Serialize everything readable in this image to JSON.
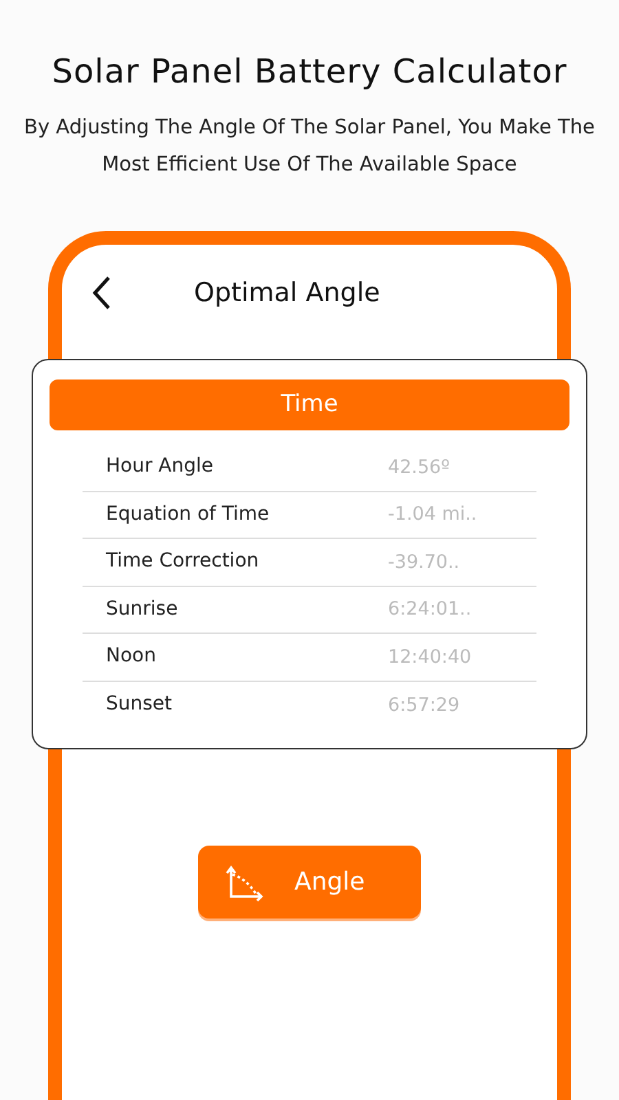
{
  "title": "Solar Panel Battery Calculator",
  "subtitle": "By Adjusting The Angle Of The Solar Panel, You Make The Most Efficient Use Of The Available Space",
  "screen": {
    "title": "Optimal Angle"
  },
  "section": {
    "title": "Time",
    "rows": [
      {
        "label": "Hour Angle",
        "value": "42.56º"
      },
      {
        "label": "Equation of Time",
        "value": "-1.04 mi.."
      },
      {
        "label": "Time Correction",
        "value": "-39.70.."
      },
      {
        "label": "Sunrise",
        "value": "6:24:01.."
      },
      {
        "label": "Noon",
        "value": "12:40:40"
      },
      {
        "label": "Sunset",
        "value": "6:57:29"
      }
    ]
  },
  "action": {
    "label": "Angle"
  }
}
